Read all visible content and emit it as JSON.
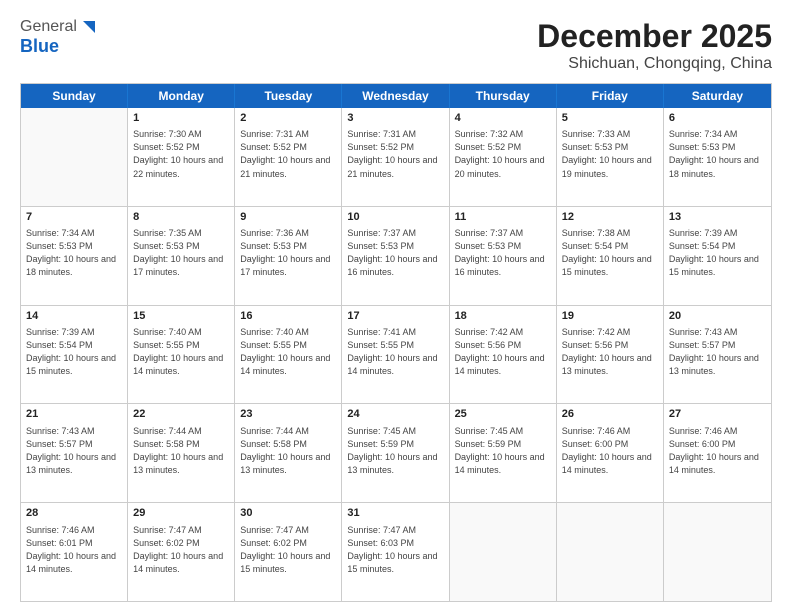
{
  "header": {
    "logo_line1": "General",
    "logo_line2": "Blue",
    "main_title": "December 2025",
    "sub_title": "Shichuan, Chongqing, China"
  },
  "days_of_week": [
    "Sunday",
    "Monday",
    "Tuesday",
    "Wednesday",
    "Thursday",
    "Friday",
    "Saturday"
  ],
  "rows": [
    [
      {
        "day": "",
        "info": ""
      },
      {
        "day": "1",
        "info": "Sunrise: 7:30 AM\nSunset: 5:52 PM\nDaylight: 10 hours and 22 minutes."
      },
      {
        "day": "2",
        "info": "Sunrise: 7:31 AM\nSunset: 5:52 PM\nDaylight: 10 hours and 21 minutes."
      },
      {
        "day": "3",
        "info": "Sunrise: 7:31 AM\nSunset: 5:52 PM\nDaylight: 10 hours and 21 minutes."
      },
      {
        "day": "4",
        "info": "Sunrise: 7:32 AM\nSunset: 5:52 PM\nDaylight: 10 hours and 20 minutes."
      },
      {
        "day": "5",
        "info": "Sunrise: 7:33 AM\nSunset: 5:53 PM\nDaylight: 10 hours and 19 minutes."
      },
      {
        "day": "6",
        "info": "Sunrise: 7:34 AM\nSunset: 5:53 PM\nDaylight: 10 hours and 18 minutes."
      }
    ],
    [
      {
        "day": "7",
        "info": "Sunrise: 7:34 AM\nSunset: 5:53 PM\nDaylight: 10 hours and 18 minutes."
      },
      {
        "day": "8",
        "info": "Sunrise: 7:35 AM\nSunset: 5:53 PM\nDaylight: 10 hours and 17 minutes."
      },
      {
        "day": "9",
        "info": "Sunrise: 7:36 AM\nSunset: 5:53 PM\nDaylight: 10 hours and 17 minutes."
      },
      {
        "day": "10",
        "info": "Sunrise: 7:37 AM\nSunset: 5:53 PM\nDaylight: 10 hours and 16 minutes."
      },
      {
        "day": "11",
        "info": "Sunrise: 7:37 AM\nSunset: 5:53 PM\nDaylight: 10 hours and 16 minutes."
      },
      {
        "day": "12",
        "info": "Sunrise: 7:38 AM\nSunset: 5:54 PM\nDaylight: 10 hours and 15 minutes."
      },
      {
        "day": "13",
        "info": "Sunrise: 7:39 AM\nSunset: 5:54 PM\nDaylight: 10 hours and 15 minutes."
      }
    ],
    [
      {
        "day": "14",
        "info": "Sunrise: 7:39 AM\nSunset: 5:54 PM\nDaylight: 10 hours and 15 minutes."
      },
      {
        "day": "15",
        "info": "Sunrise: 7:40 AM\nSunset: 5:55 PM\nDaylight: 10 hours and 14 minutes."
      },
      {
        "day": "16",
        "info": "Sunrise: 7:40 AM\nSunset: 5:55 PM\nDaylight: 10 hours and 14 minutes."
      },
      {
        "day": "17",
        "info": "Sunrise: 7:41 AM\nSunset: 5:55 PM\nDaylight: 10 hours and 14 minutes."
      },
      {
        "day": "18",
        "info": "Sunrise: 7:42 AM\nSunset: 5:56 PM\nDaylight: 10 hours and 14 minutes."
      },
      {
        "day": "19",
        "info": "Sunrise: 7:42 AM\nSunset: 5:56 PM\nDaylight: 10 hours and 13 minutes."
      },
      {
        "day": "20",
        "info": "Sunrise: 7:43 AM\nSunset: 5:57 PM\nDaylight: 10 hours and 13 minutes."
      }
    ],
    [
      {
        "day": "21",
        "info": "Sunrise: 7:43 AM\nSunset: 5:57 PM\nDaylight: 10 hours and 13 minutes."
      },
      {
        "day": "22",
        "info": "Sunrise: 7:44 AM\nSunset: 5:58 PM\nDaylight: 10 hours and 13 minutes."
      },
      {
        "day": "23",
        "info": "Sunrise: 7:44 AM\nSunset: 5:58 PM\nDaylight: 10 hours and 13 minutes."
      },
      {
        "day": "24",
        "info": "Sunrise: 7:45 AM\nSunset: 5:59 PM\nDaylight: 10 hours and 13 minutes."
      },
      {
        "day": "25",
        "info": "Sunrise: 7:45 AM\nSunset: 5:59 PM\nDaylight: 10 hours and 14 minutes."
      },
      {
        "day": "26",
        "info": "Sunrise: 7:46 AM\nSunset: 6:00 PM\nDaylight: 10 hours and 14 minutes."
      },
      {
        "day": "27",
        "info": "Sunrise: 7:46 AM\nSunset: 6:00 PM\nDaylight: 10 hours and 14 minutes."
      }
    ],
    [
      {
        "day": "28",
        "info": "Sunrise: 7:46 AM\nSunset: 6:01 PM\nDaylight: 10 hours and 14 minutes."
      },
      {
        "day": "29",
        "info": "Sunrise: 7:47 AM\nSunset: 6:02 PM\nDaylight: 10 hours and 14 minutes."
      },
      {
        "day": "30",
        "info": "Sunrise: 7:47 AM\nSunset: 6:02 PM\nDaylight: 10 hours and 15 minutes."
      },
      {
        "day": "31",
        "info": "Sunrise: 7:47 AM\nSunset: 6:03 PM\nDaylight: 10 hours and 15 minutes."
      },
      {
        "day": "",
        "info": ""
      },
      {
        "day": "",
        "info": ""
      },
      {
        "day": "",
        "info": ""
      }
    ]
  ]
}
